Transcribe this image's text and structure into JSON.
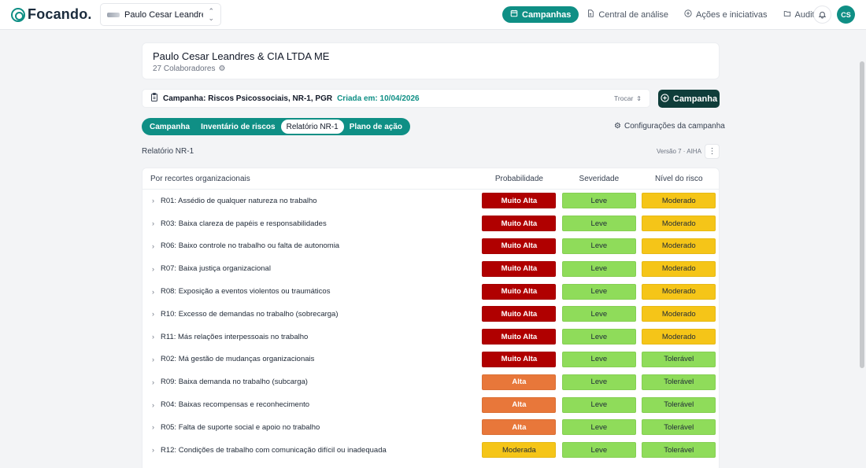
{
  "app": {
    "name": "Focando."
  },
  "company_selector": {
    "name": "Paulo Cesar Leandre..."
  },
  "nav": {
    "items": [
      {
        "label": "Campanhas",
        "icon": "calendar-icon",
        "active": true
      },
      {
        "label": "Central de análise",
        "icon": "document-icon",
        "active": false
      },
      {
        "label": "Ações e iniciativas",
        "icon": "plus-circle-icon",
        "active": false
      },
      {
        "label": "Auditoria",
        "icon": "folder-icon",
        "active": false
      }
    ],
    "avatar_initials": "CS"
  },
  "company": {
    "title": "Paulo Cesar Leandres & CIA LTDA ME",
    "collaborators": "27 Colaboradores"
  },
  "campaign": {
    "text": "Campanha: Riscos Psicossociais, NR-1, PGR",
    "created": "Criada em: 10/04/2026",
    "switch_label": "Trocar",
    "new_button": "Campanha"
  },
  "tabs": [
    "Campanha",
    "Inventário de riscos",
    "Relatório NR-1",
    "Plano de ação"
  ],
  "active_tab": 2,
  "config_link": "Configurações da campanha",
  "report": {
    "label": "Relatório NR-1",
    "version": "Versão 7 · AIHA"
  },
  "table": {
    "headers": [
      "Por recortes organizacionais",
      "Probabilidade",
      "Severidade",
      "Nível do risco"
    ],
    "rows": [
      {
        "label": "R01: Assédio de qualquer natureza no trabalho",
        "prob": "Muito Alta",
        "sev": "Leve",
        "nivel": "Moderado"
      },
      {
        "label": "R03: Baixa clareza de papéis e responsabilidades",
        "prob": "Muito Alta",
        "sev": "Leve",
        "nivel": "Moderado"
      },
      {
        "label": "R06: Baixo controle no trabalho ou falta de autonomia",
        "prob": "Muito Alta",
        "sev": "Leve",
        "nivel": "Moderado"
      },
      {
        "label": "R07: Baixa justiça organizacional",
        "prob": "Muito Alta",
        "sev": "Leve",
        "nivel": "Moderado"
      },
      {
        "label": "R08: Exposição a eventos violentos ou traumáticos",
        "prob": "Muito Alta",
        "sev": "Leve",
        "nivel": "Moderado"
      },
      {
        "label": "R10: Excesso de demandas no trabalho (sobrecarga)",
        "prob": "Muito Alta",
        "sev": "Leve",
        "nivel": "Moderado"
      },
      {
        "label": "R11: Más relações interpessoais no trabalho",
        "prob": "Muito Alta",
        "sev": "Leve",
        "nivel": "Moderado"
      },
      {
        "label": "R02: Má gestão de mudanças organizacionais",
        "prob": "Muito Alta",
        "sev": "Leve",
        "nivel": "Tolerável"
      },
      {
        "label": "R09: Baixa demanda no trabalho (subcarga)",
        "prob": "Alta",
        "sev": "Leve",
        "nivel": "Tolerável"
      },
      {
        "label": "R04: Baixas recompensas e reconhecimento",
        "prob": "Alta",
        "sev": "Leve",
        "nivel": "Tolerável"
      },
      {
        "label": "R05: Falta de suporte social e apoio no trabalho",
        "prob": "Alta",
        "sev": "Leve",
        "nivel": "Tolerável"
      },
      {
        "label": "R12: Condições de trabalho com comunicação difícil ou inadequada",
        "prob": "Moderada",
        "sev": "Leve",
        "nivel": "Tolerável"
      }
    ]
  },
  "colors": {
    "accent": "#0f8f85",
    "dark_button": "#0f3d3a",
    "muito_alta": "#b00000",
    "alta": "#e8773a",
    "moderada": "#f5c518",
    "leve": "#8fdc5a"
  }
}
